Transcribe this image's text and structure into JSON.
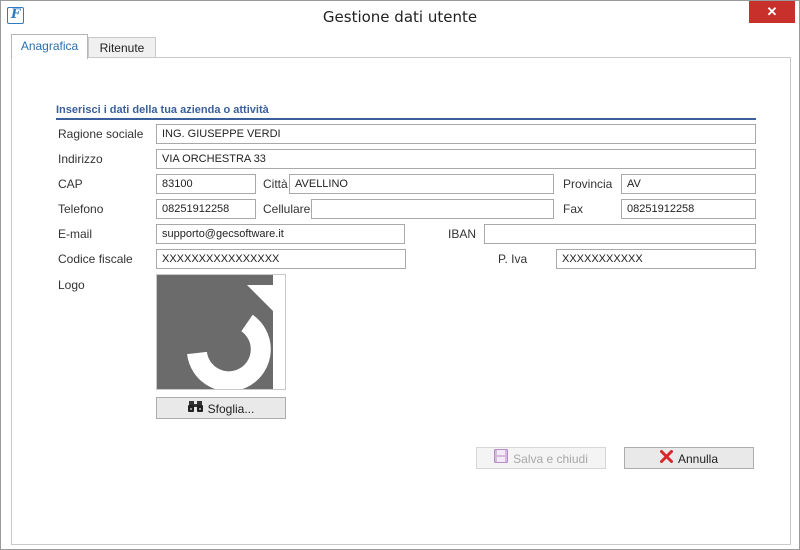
{
  "window": {
    "title": "Gestione dati utente",
    "icon_letter": "F",
    "close_glyph": "✕"
  },
  "tabs": [
    {
      "label": "Anagrafica",
      "active": true
    },
    {
      "label": "Ritenute",
      "active": false
    }
  ],
  "section": {
    "title": "Inserisci i dati della tua azienda o attività"
  },
  "form": {
    "ragione_sociale": {
      "label": "Ragione sociale",
      "value": "ING. GIUSEPPE VERDI"
    },
    "indirizzo": {
      "label": "Indirizzo",
      "value": "VIA ORCHESTRA 33"
    },
    "cap": {
      "label": "CAP",
      "value": "83100"
    },
    "citta": {
      "label": "Città",
      "value": "AVELLINO"
    },
    "provincia": {
      "label": "Provincia",
      "value": "AV"
    },
    "telefono": {
      "label": "Telefono",
      "value": "08251912258"
    },
    "cellulare": {
      "label": "Cellulare",
      "value": ""
    },
    "fax": {
      "label": "Fax",
      "value": "08251912258"
    },
    "email": {
      "label": "E-mail",
      "value": "supporto@gecsoftware.it"
    },
    "iban": {
      "label": "IBAN",
      "value": ""
    },
    "codice_fiscale": {
      "label": "Codice fiscale",
      "value": "XXXXXXXXXXXXXXXX"
    },
    "piva": {
      "label": "P. Iva",
      "value": "XXXXXXXXXXX"
    },
    "logo": {
      "label": "Logo"
    }
  },
  "buttons": {
    "browse": {
      "label": "Sfoglia...",
      "icon": "binoculars-icon"
    },
    "save": {
      "label": "Salva e chiudi",
      "icon": "floppy-disk-icon",
      "enabled": false
    },
    "cancel": {
      "label": "Annulla",
      "icon": "red-x-icon"
    }
  },
  "colors": {
    "accent": "#2a6fb0",
    "section": "#3a5f9a",
    "close": "#c7302b",
    "cancel_x": "#d8262a",
    "logo_bg": "#6b6b6b"
  }
}
